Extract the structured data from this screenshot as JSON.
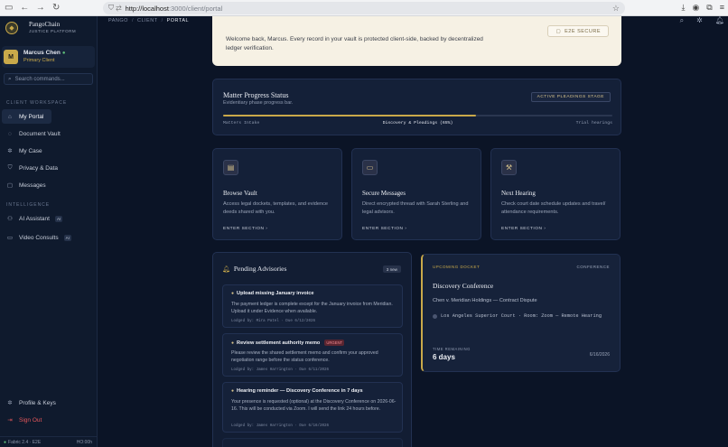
{
  "browser": {
    "url_host": "http://localhost",
    "url_path": ":3000/client/portal"
  },
  "brand": {
    "name": "PangoChain",
    "tagline": "JUSTICE PLATFORM"
  },
  "user": {
    "initial": "M",
    "name": "Marcus Chen",
    "role": "Primary Client"
  },
  "search": {
    "placeholder": "Search commands..."
  },
  "sidebar": {
    "workspace_label": "CLIENT WORKSPACE",
    "workspace_items": [
      {
        "label": "My Portal",
        "icon": "home-icon"
      },
      {
        "label": "Document Vault",
        "icon": "vault-icon"
      },
      {
        "label": "My Case",
        "icon": "gear-icon"
      },
      {
        "label": "Privacy & Data",
        "icon": "shield-icon"
      },
      {
        "label": "Messages",
        "icon": "chat-icon"
      }
    ],
    "intel_label": "INTELLIGENCE",
    "intel_items": [
      {
        "label": "AI Assistant",
        "tag": "AI",
        "icon": "robot-icon"
      },
      {
        "label": "Video Consults",
        "tag": "AI",
        "icon": "video-icon"
      }
    ],
    "profile_label": "Profile & Keys",
    "signout_label": "Sign Out",
    "footer_left": "Fabric 2.4 · E2E",
    "footer_right": "HO:00h"
  },
  "breadcrumb": {
    "a": "PANGO",
    "b": "CLIENT",
    "c": "PORTAL"
  },
  "welcome": {
    "text": "Welcome back, Marcus. Every record in your vault is protected client-side, backed by decentralized ledger verification.",
    "button": "E2E SECURE"
  },
  "progress": {
    "title": "Matter Progress Status",
    "subtitle": "Evidentiary phase progress bar.",
    "badge": "ACTIVE PLEADINGS STAGE",
    "percent": 65,
    "start": "Matters Intake",
    "middle": "Discovery & Pleadings (65%)",
    "end": "Trial hearings"
  },
  "tiles": [
    {
      "title": "Browse Vault",
      "desc": "Access legal dockets, templates, and evidence deeds shared with you.",
      "link": "ENTER SECTION ›"
    },
    {
      "title": "Secure Messages",
      "desc": "Direct encrypted thread with Sarah Sterling and legal advisors.",
      "link": "ENTER SECTION ›"
    },
    {
      "title": "Next Hearing",
      "desc": "Check court date schedule updates and travel/ attendance requirements.",
      "link": "ENTER SECTION ›"
    }
  ],
  "advisories": {
    "title": "Pending Advisories",
    "count": "3 new",
    "items": [
      {
        "title": "Upload missing January invoice",
        "body": "The payment ledger is complete except for the January invoice from Meridian. Upload it under Evidence when available.",
        "meta": "Lodged by: Mira Patel · Due 6/12/2026",
        "urgent": ""
      },
      {
        "title": "Review settlement authority memo",
        "body": "Please review the shared settlement memo and confirm your approved negotiation range before the status conference.",
        "meta": "Lodged by: James Harrington · Due 6/11/2026",
        "urgent": "URGENT"
      },
      {
        "title": "Hearing reminder — Discovery Conference in 7 days",
        "body": "Your presence is requested (optional) at the Discovery Conference on 2026-06-16. This will be conducted via Zoom. I will send the link 24 hours before.",
        "meta": "Lodged by: James Harrington · Due 6/16/2026",
        "urgent": ""
      }
    ]
  },
  "docket": {
    "kicker": "UPCOMING DOCKET",
    "kicker_right": "CONFERENCE",
    "title": "Discovery Conference",
    "case": "Chen v. Meridian Holdings — Contract Dispute",
    "location": "Los Angeles Superior Court · Room: Zoom — Remote Hearing",
    "remaining_label": "TIME REMAINING",
    "remaining": "6 days",
    "date": "6/16/2026"
  },
  "colors": {
    "accent": "#c9a94a",
    "bg": "#0b1426",
    "urgent": "#f08a90"
  }
}
